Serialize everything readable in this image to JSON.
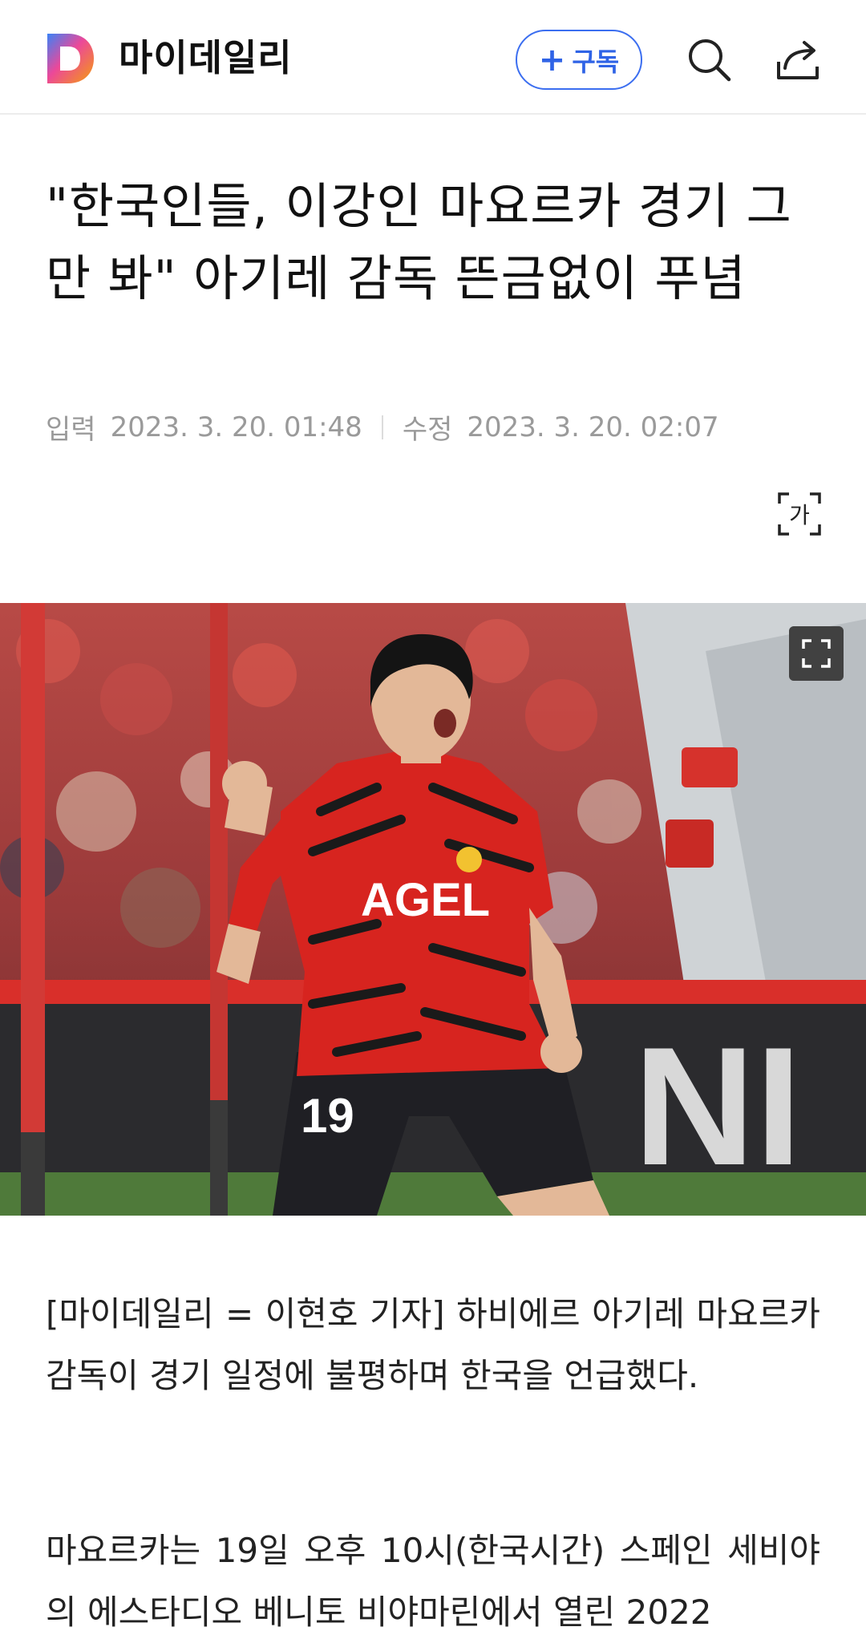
{
  "header": {
    "logo_letter": "D",
    "brand": "마이데일리",
    "subscribe_label": "구독",
    "subscribe_plus": "+",
    "icons": [
      "search-icon",
      "share-icon"
    ],
    "accent_color": "#2f63e6"
  },
  "article": {
    "title": "\"한국인들, 이강인 마요르카 경기 그만 봐\" 아기레 감독 뜬금없이 푸념",
    "input_label": "입력",
    "input_time": "2023. 3. 20. 01:48",
    "edit_label": "수정",
    "edit_time": "2023. 3. 20. 02:07",
    "font_size_icon_text": "가",
    "image": {
      "jersey_brand": "AGEL",
      "jersey_number": "19",
      "board_text": "NI"
    },
    "paragraphs": [
      "[마이데일리 = 이현호 기자] 하비에르 아기레 마요르카 감독이 경기 일정에 불평하며 한국을 언급했다.",
      "마요르카는 19일 오후 10시(한국시간) 스페인 세비야의 에스타디오 베니토 비야마린에서 열린 2022"
    ]
  }
}
